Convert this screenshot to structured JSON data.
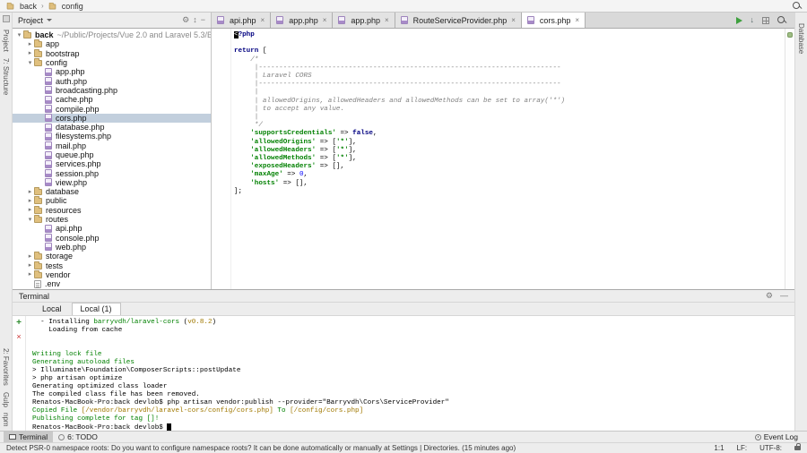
{
  "colors": {
    "terminal_green": "#008000",
    "terminal_yellow": "#A07800",
    "selection": "#C2CFDD",
    "run_green": "#3FA03F"
  },
  "navbar": {
    "crumbs": [
      "back",
      "config"
    ]
  },
  "project_panel": {
    "title": "Project"
  },
  "left_stripe": {
    "top": [
      "Project",
      "7: Structure"
    ],
    "bottom": [
      "2: Favorites",
      "Gulp",
      "npm"
    ]
  },
  "right_stripe": {
    "top": [
      "Database"
    ]
  },
  "editor_tabs": [
    {
      "label": "api.php",
      "active": false
    },
    {
      "label": "app.php",
      "active": false
    },
    {
      "label": "app.php",
      "active": false
    },
    {
      "label": "RouteServiceProvider.php",
      "active": false
    },
    {
      "label": "cors.php",
      "active": true
    }
  ],
  "tree": [
    {
      "depth": 0,
      "kind": "folder",
      "state": "open",
      "label": "back",
      "suffix": "~/Public/Projects/Vue 2.0 and Laravel 5.3/B",
      "bold": true
    },
    {
      "depth": 1,
      "kind": "folder",
      "state": "closed",
      "label": "app"
    },
    {
      "depth": 1,
      "kind": "folder",
      "state": "closed",
      "label": "bootstrap"
    },
    {
      "depth": 1,
      "kind": "folder",
      "state": "open",
      "label": "config"
    },
    {
      "depth": 2,
      "kind": "php",
      "label": "app.php"
    },
    {
      "depth": 2,
      "kind": "php",
      "label": "auth.php"
    },
    {
      "depth": 2,
      "kind": "php",
      "label": "broadcasting.php"
    },
    {
      "depth": 2,
      "kind": "php",
      "label": "cache.php"
    },
    {
      "depth": 2,
      "kind": "php",
      "label": "compile.php"
    },
    {
      "depth": 2,
      "kind": "php",
      "label": "cors.php",
      "selected": true
    },
    {
      "depth": 2,
      "kind": "php",
      "label": "database.php"
    },
    {
      "depth": 2,
      "kind": "php",
      "label": "filesystems.php"
    },
    {
      "depth": 2,
      "kind": "php",
      "label": "mail.php"
    },
    {
      "depth": 2,
      "kind": "php",
      "label": "queue.php"
    },
    {
      "depth": 2,
      "kind": "php",
      "label": "services.php"
    },
    {
      "depth": 2,
      "kind": "php",
      "label": "session.php"
    },
    {
      "depth": 2,
      "kind": "php",
      "label": "view.php"
    },
    {
      "depth": 1,
      "kind": "folder",
      "state": "closed",
      "label": "database"
    },
    {
      "depth": 1,
      "kind": "folder",
      "state": "closed",
      "label": "public"
    },
    {
      "depth": 1,
      "kind": "folder",
      "state": "closed",
      "label": "resources"
    },
    {
      "depth": 1,
      "kind": "folder",
      "state": "open",
      "label": "routes"
    },
    {
      "depth": 2,
      "kind": "php",
      "label": "api.php"
    },
    {
      "depth": 2,
      "kind": "php",
      "label": "console.php"
    },
    {
      "depth": 2,
      "kind": "php",
      "label": "web.php"
    },
    {
      "depth": 1,
      "kind": "folder",
      "state": "closed",
      "label": "storage"
    },
    {
      "depth": 1,
      "kind": "folder",
      "state": "closed",
      "label": "tests"
    },
    {
      "depth": 1,
      "kind": "folder",
      "state": "closed",
      "label": "vendor"
    },
    {
      "depth": 1,
      "kind": "env",
      "label": ".env"
    }
  ],
  "editor": {
    "lines": [
      [
        {
          "t": "<",
          "c": "caret"
        },
        {
          "t": "?php",
          "c": "tag"
        }
      ],
      [],
      [
        {
          "t": "return",
          "c": "kw"
        },
        {
          "t": " [",
          "c": "pl"
        }
      ],
      [
        {
          "t": "    ",
          "c": "pl"
        },
        {
          "t": "/*",
          "c": "cm"
        }
      ],
      [
        {
          "t": "     |--------------------------------------------------------------------------",
          "c": "cm"
        }
      ],
      [
        {
          "t": "     | Laravel CORS",
          "c": "cm"
        }
      ],
      [
        {
          "t": "     |--------------------------------------------------------------------------",
          "c": "cm"
        }
      ],
      [
        {
          "t": "     |",
          "c": "cm"
        }
      ],
      [
        {
          "t": "     | allowedOrigins, allowedHeaders and allowedMethods can be set to array('*')",
          "c": "cm"
        }
      ],
      [
        {
          "t": "     | to accept any value.",
          "c": "cm"
        }
      ],
      [
        {
          "t": "     |",
          "c": "cm"
        }
      ],
      [
        {
          "t": "     */",
          "c": "cm"
        }
      ],
      [
        {
          "t": "    ",
          "c": "pl"
        },
        {
          "t": "'supportsCredentials'",
          "c": "str"
        },
        {
          "t": " => ",
          "c": "pl"
        },
        {
          "t": "false",
          "c": "kw"
        },
        {
          "t": ",",
          "c": "pl"
        }
      ],
      [
        {
          "t": "    ",
          "c": "pl"
        },
        {
          "t": "'allowedOrigins'",
          "c": "str"
        },
        {
          "t": " => [",
          "c": "pl"
        },
        {
          "t": "'*'",
          "c": "str"
        },
        {
          "t": "],",
          "c": "pl"
        }
      ],
      [
        {
          "t": "    ",
          "c": "pl"
        },
        {
          "t": "'allowedHeaders'",
          "c": "str"
        },
        {
          "t": " => [",
          "c": "pl"
        },
        {
          "t": "'*'",
          "c": "str"
        },
        {
          "t": "],",
          "c": "pl"
        }
      ],
      [
        {
          "t": "    ",
          "c": "pl"
        },
        {
          "t": "'allowedMethods'",
          "c": "str"
        },
        {
          "t": " => [",
          "c": "pl"
        },
        {
          "t": "'*'",
          "c": "str"
        },
        {
          "t": "],",
          "c": "pl"
        }
      ],
      [
        {
          "t": "    ",
          "c": "pl"
        },
        {
          "t": "'exposedHeaders'",
          "c": "str"
        },
        {
          "t": " => [],",
          "c": "pl"
        }
      ],
      [
        {
          "t": "    ",
          "c": "pl"
        },
        {
          "t": "'maxAge'",
          "c": "str"
        },
        {
          "t": " => ",
          "c": "pl"
        },
        {
          "t": "0",
          "c": "num"
        },
        {
          "t": ",",
          "c": "pl"
        }
      ],
      [
        {
          "t": "    ",
          "c": "pl"
        },
        {
          "t": "'hosts'",
          "c": "str"
        },
        {
          "t": " => [],",
          "c": "pl"
        }
      ],
      [
        {
          "t": "];",
          "c": "pl"
        }
      ]
    ]
  },
  "terminal": {
    "title": "Terminal",
    "tabs": [
      {
        "label": "Local",
        "active": false
      },
      {
        "label": "Local (1)",
        "active": true
      }
    ],
    "lines": [
      [
        {
          "t": "  - Installing ",
          "c": "fg"
        },
        {
          "t": "barryvdh/laravel-cors",
          "c": "green"
        },
        {
          "t": " (",
          "c": "fg"
        },
        {
          "t": "v0.8.2",
          "c": "yellow"
        },
        {
          "t": ")",
          "c": "fg"
        }
      ],
      [
        {
          "t": "    Loading from cache",
          "c": "fg"
        }
      ],
      [],
      [],
      [
        {
          "t": "Writing lock file",
          "c": "green"
        }
      ],
      [
        {
          "t": "Generating autoload files",
          "c": "green"
        }
      ],
      [
        {
          "t": "> Illuminate\\Foundation\\ComposerScripts::postUpdate",
          "c": "fg"
        }
      ],
      [
        {
          "t": "> php artisan optimize",
          "c": "fg"
        }
      ],
      [
        {
          "t": "Generating optimized class loader",
          "c": "fg"
        }
      ],
      [
        {
          "t": "The compiled class file has been removed.",
          "c": "fg"
        }
      ],
      [
        {
          "t": "Renatos-MacBook-Pro:back devlob$ php artisan vendor:publish --provider=\"Barryvdh\\Cors\\ServiceProvider\"",
          "c": "fg"
        }
      ],
      [
        {
          "t": "Copied File ",
          "c": "green"
        },
        {
          "t": "[/vendor/barryvdh/laravel-cors/config/cors.php]",
          "c": "yellow"
        },
        {
          "t": " To ",
          "c": "green"
        },
        {
          "t": "[/config/cors.php]",
          "c": "yellow"
        }
      ],
      [
        {
          "t": "Publishing complete for tag []!",
          "c": "green"
        }
      ],
      [
        {
          "t": "Renatos-MacBook-Pro:back devlob$ ",
          "c": "fg"
        },
        {
          "t": " ",
          "c": "cur"
        }
      ]
    ]
  },
  "bottom_bar": {
    "buttons": [
      {
        "label": "Terminal",
        "icon": "terminal-icon",
        "pressed": true
      },
      {
        "label": "6: TODO",
        "icon": "todo-icon",
        "pressed": false
      }
    ],
    "event_log": "Event Log"
  },
  "status_bar": {
    "message": "Detect PSR-0 namespace roots: Do you want to configure namespace roots? It can be done automatically or manually at Settings | Directories. (15 minutes ago)",
    "position": "1:1",
    "line_sep": "LF:",
    "encoding": "UTF-8:"
  }
}
